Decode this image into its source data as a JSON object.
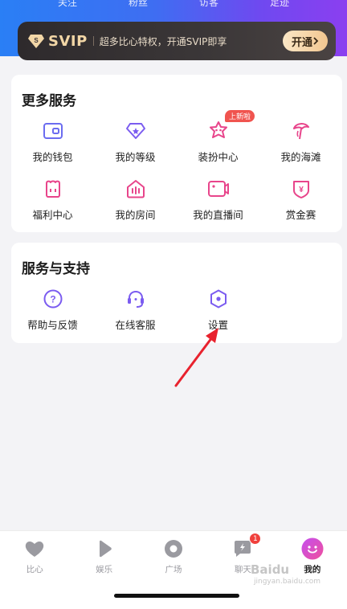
{
  "top_tabs": [
    "关注",
    "粉丝",
    "访客",
    "足迹"
  ],
  "svip": {
    "title": "SVIP",
    "desc": "超多比心特权，开通SVIP即享",
    "button": "开通"
  },
  "more_services": {
    "title": "更多服务",
    "items": [
      {
        "label": "我的钱包",
        "icon": "wallet-icon"
      },
      {
        "label": "我的等级",
        "icon": "level-icon"
      },
      {
        "label": "装扮中心",
        "icon": "dress-up-icon",
        "tag": "上新啦"
      },
      {
        "label": "我的海滩",
        "icon": "beach-icon"
      },
      {
        "label": "福利中心",
        "icon": "welfare-icon"
      },
      {
        "label": "我的房间",
        "icon": "room-icon"
      },
      {
        "label": "我的直播间",
        "icon": "live-room-icon"
      },
      {
        "label": "赏金赛",
        "icon": "bounty-icon"
      }
    ]
  },
  "support": {
    "title": "服务与支持",
    "items": [
      {
        "label": "帮助与反馈",
        "icon": "help-icon"
      },
      {
        "label": "在线客服",
        "icon": "customer-service-icon"
      },
      {
        "label": "设置",
        "icon": "settings-icon"
      }
    ]
  },
  "tabbar": {
    "items": [
      {
        "label": "比心",
        "icon": "heart-icon"
      },
      {
        "label": "娱乐",
        "icon": "play-icon"
      },
      {
        "label": "广场",
        "icon": "circle-icon"
      },
      {
        "label": "聊天",
        "icon": "chat-icon",
        "badge": "1"
      },
      {
        "label": "我的",
        "icon": "profile-icon",
        "active": true
      }
    ]
  },
  "watermark": {
    "text": "Baidu",
    "sub": "jingyan.baidu.com"
  },
  "colors": {
    "accent_purple": "#7b5cf0",
    "accent_pink": "#e8458b",
    "badge_red": "#f0403c"
  }
}
